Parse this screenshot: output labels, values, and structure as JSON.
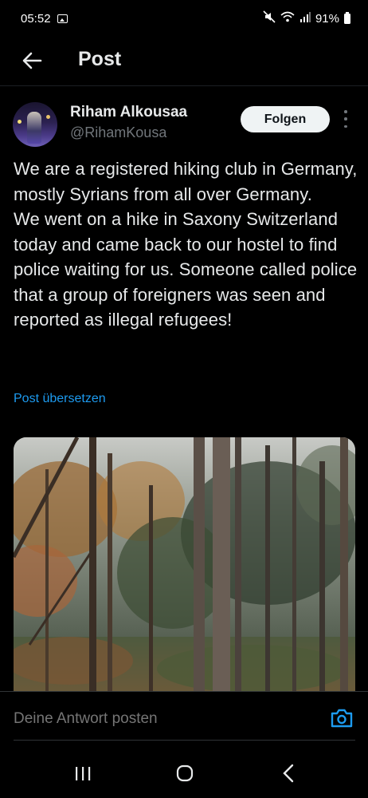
{
  "status_bar": {
    "time": "05:52",
    "battery": "91%",
    "icons": [
      "gallery-icon",
      "mute-icon",
      "wifi-icon",
      "signal-icon",
      "battery-icon"
    ]
  },
  "header": {
    "title": "Post",
    "back_icon": "arrow-left-icon"
  },
  "post": {
    "author_name": "Riham Alkousaa",
    "author_handle": "@RihamKousa",
    "follow_label": "Folgen",
    "more_icon": "more-vertical-icon",
    "text": "We are a registered hiking club in Germany, mostly Syrians from all over Germany.\nWe went on a hike in Saxony Switzerland today and came back to our hostel to find police waiting for us. Someone called police that a group of foreigners was seen and reported as illegal refugees!",
    "translate_label": "Post übersetzen"
  },
  "reply": {
    "placeholder": "Deine Antwort posten",
    "camera_icon": "camera-icon"
  },
  "nav": {
    "icons": [
      "recent-apps-icon",
      "home-icon",
      "back-icon"
    ]
  },
  "colors": {
    "background": "#000000",
    "text": "#e7e9ea",
    "secondary": "#71767b",
    "link": "#1d9bf0",
    "follow_bg": "#eff3f4"
  }
}
